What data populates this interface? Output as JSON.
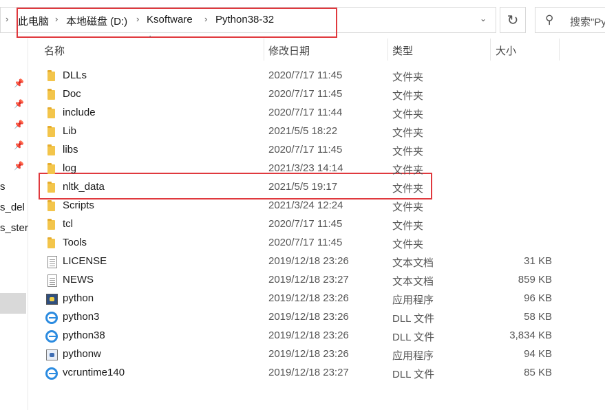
{
  "breadcrumb": {
    "items": [
      "此电脑",
      "本地磁盘 (D:)",
      "Ksoftware",
      "Python38-32"
    ],
    "separator": "›"
  },
  "search": {
    "placeholder": "搜索\"Py"
  },
  "nav_pane": {
    "items": [
      "s",
      "s_del",
      "s_ster"
    ]
  },
  "columns": {
    "name": "名称",
    "date": "修改日期",
    "type": "类型",
    "size": "大小"
  },
  "files": [
    {
      "name": "DLLs",
      "date": "2020/7/17 11:45",
      "type": "文件夹",
      "size": "",
      "icon": "folder-icon"
    },
    {
      "name": "Doc",
      "date": "2020/7/17 11:45",
      "type": "文件夹",
      "size": "",
      "icon": "folder-icon"
    },
    {
      "name": "include",
      "date": "2020/7/17 11:44",
      "type": "文件夹",
      "size": "",
      "icon": "folder-icon"
    },
    {
      "name": "Lib",
      "date": "2021/5/5 18:22",
      "type": "文件夹",
      "size": "",
      "icon": "folder-icon"
    },
    {
      "name": "libs",
      "date": "2020/7/17 11:45",
      "type": "文件夹",
      "size": "",
      "icon": "folder-icon"
    },
    {
      "name": "log",
      "date": "2021/3/23 14:14",
      "type": "文件夹",
      "size": "",
      "icon": "folder-icon"
    },
    {
      "name": "nltk_data",
      "date": "2021/5/5 19:17",
      "type": "文件夹",
      "size": "",
      "icon": "folder-icon"
    },
    {
      "name": "Scripts",
      "date": "2021/3/24 12:24",
      "type": "文件夹",
      "size": "",
      "icon": "folder-icon"
    },
    {
      "name": "tcl",
      "date": "2020/7/17 11:45",
      "type": "文件夹",
      "size": "",
      "icon": "folder-icon"
    },
    {
      "name": "Tools",
      "date": "2020/7/17 11:45",
      "type": "文件夹",
      "size": "",
      "icon": "folder-icon"
    },
    {
      "name": "LICENSE",
      "date": "2019/12/18 23:26",
      "type": "文本文档",
      "size": "31 KB",
      "icon": "text-document-icon"
    },
    {
      "name": "NEWS",
      "date": "2019/12/18 23:27",
      "type": "文本文档",
      "size": "859 KB",
      "icon": "text-document-icon"
    },
    {
      "name": "python",
      "date": "2019/12/18 23:26",
      "type": "应用程序",
      "size": "96 KB",
      "icon": "python-app-icon"
    },
    {
      "name": "python3",
      "date": "2019/12/18 23:26",
      "type": "DLL 文件",
      "size": "58 KB",
      "icon": "dll-icon"
    },
    {
      "name": "python38",
      "date": "2019/12/18 23:26",
      "type": "DLL 文件",
      "size": "3,834 KB",
      "icon": "dll-icon"
    },
    {
      "name": "pythonw",
      "date": "2019/12/18 23:26",
      "type": "应用程序",
      "size": "94 KB",
      "icon": "pythonw-app-icon"
    },
    {
      "name": "vcruntime140",
      "date": "2019/12/18 23:27",
      "type": "DLL 文件",
      "size": "85 KB",
      "icon": "dll-icon"
    }
  ],
  "highlight_color": "#e0393e"
}
